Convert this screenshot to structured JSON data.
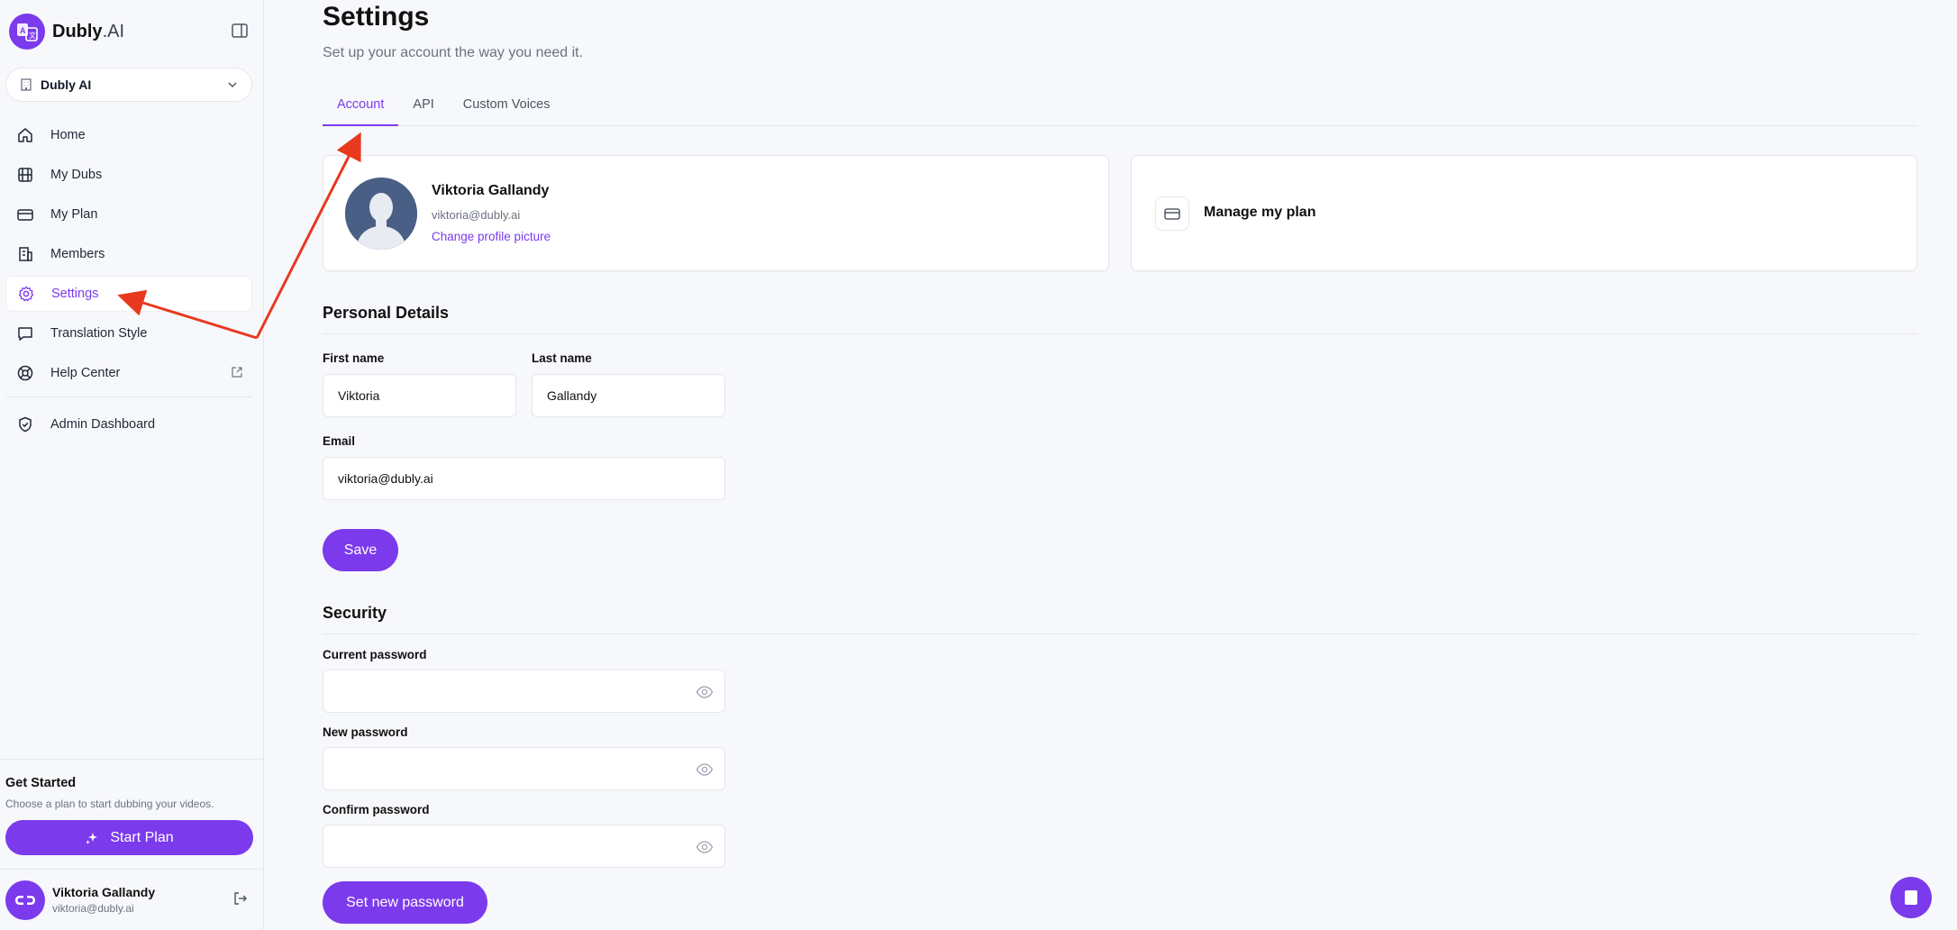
{
  "brand": {
    "name_bold": "Dubly",
    "name_rest": ".AI",
    "accent": "#7c3aed"
  },
  "workspace": {
    "name": "Dubly AI"
  },
  "sidebar": {
    "items": [
      {
        "label": "Home",
        "icon": "home-icon"
      },
      {
        "label": "My Dubs",
        "icon": "film-icon"
      },
      {
        "label": "My Plan",
        "icon": "credit-card-icon"
      },
      {
        "label": "Members",
        "icon": "building-icon"
      },
      {
        "label": "Settings",
        "icon": "gear-icon",
        "active": true
      },
      {
        "label": "Translation Style",
        "icon": "message-square-icon"
      },
      {
        "label": "Help Center",
        "icon": "life-buoy-icon",
        "external": true
      },
      {
        "label": "Admin Dashboard",
        "icon": "shield-check-icon"
      }
    ],
    "get_started": {
      "title": "Get Started",
      "subtitle": "Choose a plan to start dubbing your videos.",
      "button": "Start Plan"
    },
    "user": {
      "name": "Viktoria Gallandy",
      "email": "viktoria@dubly.ai"
    }
  },
  "page": {
    "title": "Settings",
    "subtitle": "Set up your account the way you need it.",
    "tabs": [
      "Account",
      "API",
      "Custom Voices"
    ],
    "active_tab": "Account"
  },
  "profile_card": {
    "name": "Viktoria Gallandy",
    "email": "viktoria@dubly.ai",
    "change_picture": "Change profile picture"
  },
  "plan_card": {
    "label": "Manage my plan"
  },
  "personal": {
    "title": "Personal Details",
    "first_name_label": "First name",
    "first_name_value": "Viktoria",
    "last_name_label": "Last name",
    "last_name_value": "Gallandy",
    "email_label": "Email",
    "email_value": "viktoria@dubly.ai",
    "save": "Save"
  },
  "security": {
    "title": "Security",
    "current_label": "Current password",
    "new_label": "New password",
    "confirm_label": "Confirm password",
    "submit": "Set new password"
  }
}
